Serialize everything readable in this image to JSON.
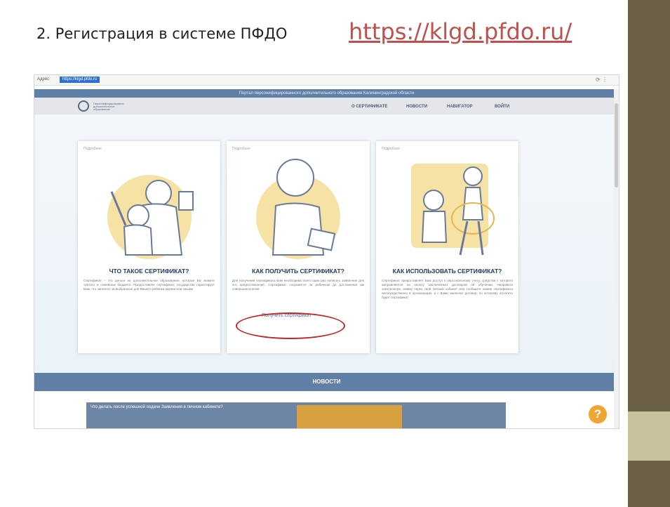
{
  "slide": {
    "title": "2. Регистрация в системе ПФДО",
    "link": "https://klgd.pfdo.ru/"
  },
  "browser": {
    "address_label": "Адрес",
    "url": "https://klgd.pfdo.ru"
  },
  "site": {
    "portal_title": "Портал персонифицированного дополнительного образования Калининградской области",
    "logo_text": "Персонифицированное дополнительное образование",
    "nav": [
      "О СЕРТИФИКАТЕ",
      "НОВОСТИ",
      "НАВИГАТОР",
      "ВОЙТИ"
    ]
  },
  "cards": [
    {
      "more": "Подробнее",
      "title": "ЧТО ТАКОЕ СЕРТИФИКАТ?",
      "text": "Сертификат – это деньги на дополнительное образование, которые Вы можете тратить в семейном бюджете. Предоставляя сертификат, государство гарантирует Вам, что заплатит за выбранные для Вашего ребенка кружки или секции"
    },
    {
      "more": "Подробнее",
      "title": "КАК ПОЛУЧИТЬ СЕРТИФИКАТ?",
      "text": "Для получения сертификата Вам необходимо всего один раз написать заявление для его предоставления. Сертификат сохранится за ребенком до достижения им совершеннолетия",
      "link": "Получить сертификат"
    },
    {
      "more": "Подробнее",
      "title": "КАК ИСПОЛЬЗОВАТЬ СЕРТИФИКАТ?",
      "text": "Сертификат предоставляет Вам доступ к персональному счету, средства с которого направляются на оплату заключенных договоров об обучении. Направьте электронную заявку через свой личный кабинет или сообщите номер сертификата непосредственно в организацию, и с Вами заключат договор, по которому оплатить будет сертификат"
    }
  ],
  "news": {
    "header": "НОВОСТИ",
    "item": "Что делать после успешной подачи Заявления в личном кабинете?"
  },
  "help": {
    "label": "?"
  },
  "colors": {
    "accent": "#c0504d",
    "nav_bar": "#5f7fa6",
    "help": "#f0a431",
    "deco_dark": "#6b6045",
    "deco_light": "#c8c29c"
  }
}
